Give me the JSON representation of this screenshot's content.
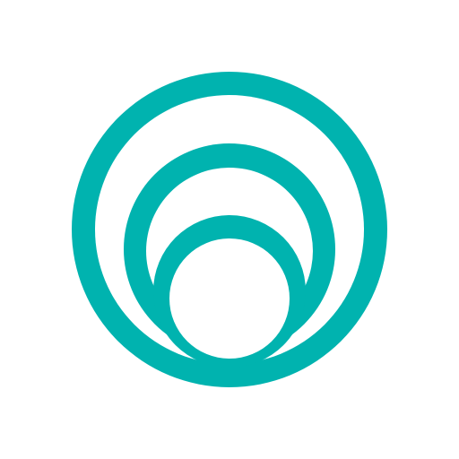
{
  "logo": {
    "icon": "nested-circles-logo-icon",
    "color": "#00B3AF",
    "background": "#FFFFFF"
  }
}
